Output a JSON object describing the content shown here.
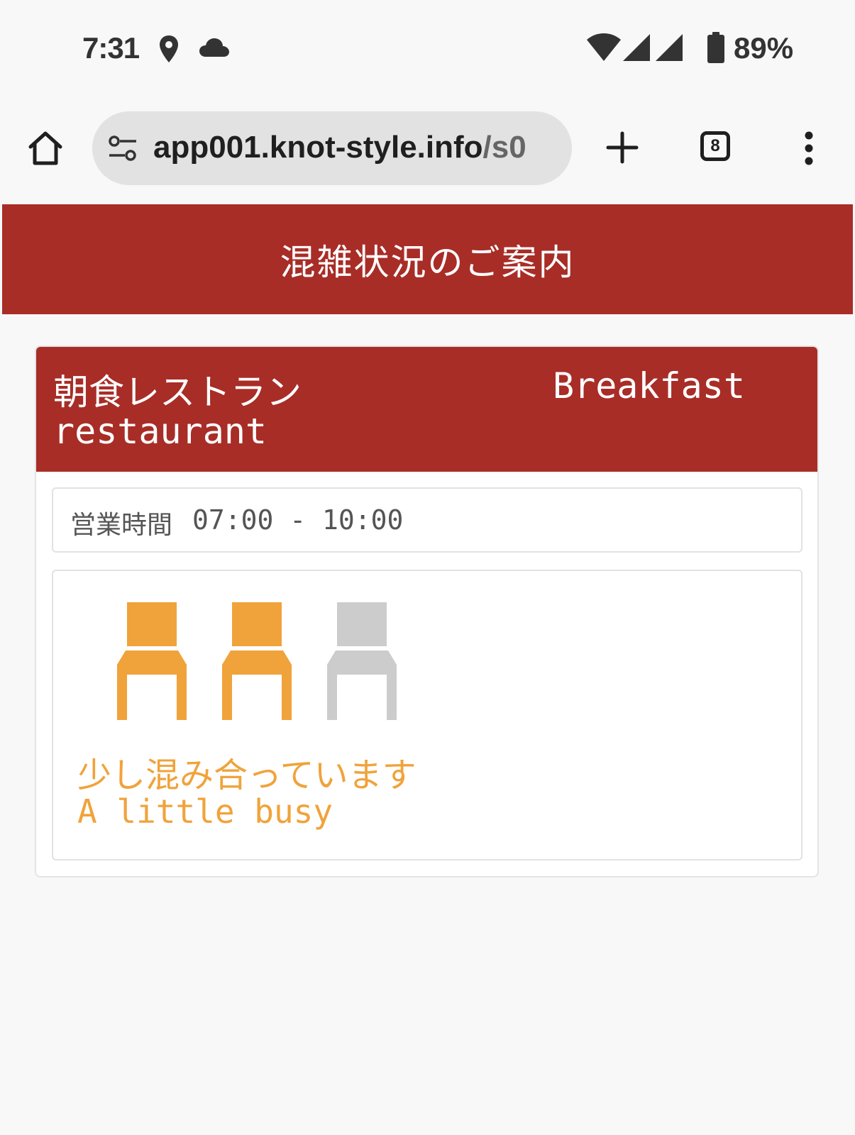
{
  "status_bar": {
    "time": "7:31",
    "icons": [
      "location-icon",
      "cloud-icon",
      "wifi-icon",
      "signal-icon",
      "signal-icon",
      "battery-icon"
    ],
    "battery": "89%"
  },
  "browser": {
    "url_host": "app001.knot-style.info",
    "url_path": "/s0",
    "tab_count": "8",
    "icons": [
      "home-icon",
      "site-settings-icon",
      "new-tab-icon",
      "tabs-icon",
      "more-options-icon"
    ]
  },
  "page": {
    "title": "混雑状況のご案内"
  },
  "restaurant": {
    "name_jp": "朝食レストラン",
    "name_en_line1": "Breakfast",
    "name_en_line2": "restaurant",
    "hours_label": "営業時間",
    "hours_value": "07:00 - 10:00",
    "congestion_level": 2,
    "congestion_max": 3,
    "status_jp": "少し混み合っています",
    "status_en": "A little busy"
  },
  "colors": {
    "brand_red": "#a82d27",
    "busy_orange": "#f0a33b",
    "chair_inactive": "#cccccc"
  }
}
